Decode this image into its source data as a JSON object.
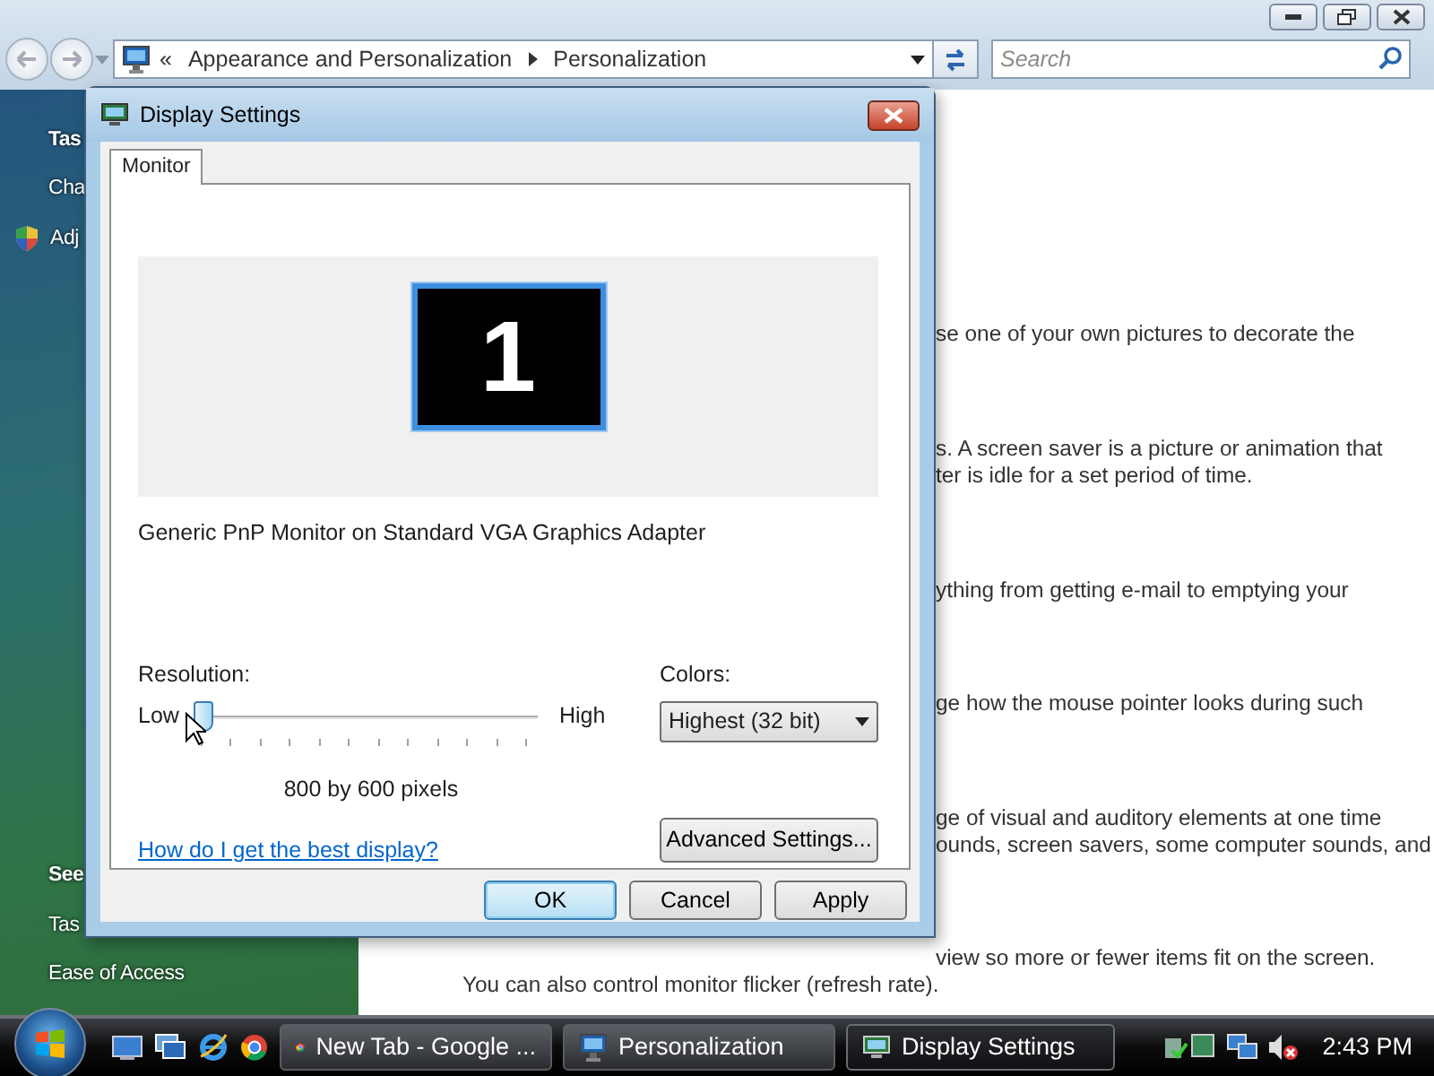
{
  "explorer": {
    "address_bar": {
      "chevron": "«",
      "breadcrumbs": [
        "Appearance and Personalization",
        "Personalization"
      ]
    },
    "search": {
      "placeholder": "Search"
    },
    "sidebar": {
      "sections": [
        {
          "heading": "Tas",
          "items": [
            {
              "label": "Cha",
              "kind": "plain"
            },
            {
              "label": "Adj",
              "kind": "shield"
            }
          ]
        },
        {
          "heading": "See",
          "items": [
            {
              "label": "Tas",
              "kind": "plain"
            },
            {
              "label": "Ease of Access",
              "kind": "plain"
            }
          ]
        }
      ]
    },
    "paragraphs": [
      {
        "lines": [
          {
            "text": "se one of your own pictures to decorate the",
            "kind": "cut"
          }
        ]
      },
      {
        "lines": [
          {
            "text": "s. A screen saver is a picture or animation that",
            "kind": "cut"
          },
          {
            "text": "ter is idle for a set period of time.",
            "kind": "cut"
          }
        ]
      },
      {
        "lines": [
          {
            "text": "ything from getting e-mail to emptying your",
            "kind": "cut"
          }
        ]
      },
      {
        "lines": [
          {
            "text": "ge how the mouse pointer looks during such",
            "kind": "cut"
          }
        ]
      },
      {
        "lines": [
          {
            "text": "ge of visual and auditory elements at one time",
            "kind": "cut"
          },
          {
            "text": "ounds, screen savers, some computer sounds, and",
            "kind": "cut"
          }
        ]
      },
      {
        "lines": [
          {
            "text": "view so more or fewer items fit on the screen.",
            "kind": "cut"
          },
          {
            "text": "You can also control monitor flicker (refresh rate).",
            "kind": "full"
          }
        ]
      }
    ]
  },
  "dialog": {
    "title": "Display Settings",
    "tabs": [
      {
        "label": "Monitor",
        "selected": true
      }
    ],
    "monitor_number": "1",
    "monitor_description": "Generic PnP Monitor on Standard VGA Graphics Adapter",
    "resolution": {
      "label": "Resolution:",
      "low": "Low",
      "high": "High",
      "level": 0,
      "reading": "800 by 600 pixels"
    },
    "colors": {
      "label": "Colors:",
      "value": "Highest (32 bit)"
    },
    "help_link": "How do I get the best display?",
    "advanced_button": "Advanced Settings...",
    "buttons": [
      {
        "label": "OK",
        "default": true
      },
      {
        "label": "Cancel",
        "default": false
      },
      {
        "label": "Apply",
        "default": false
      }
    ]
  },
  "taskbar": {
    "tasks": [
      {
        "label": "New Tab - Google ...",
        "kind": "browser",
        "selected": false
      },
      {
        "label": "Personalization",
        "kind": "monitor",
        "selected": false
      },
      {
        "label": "Display Settings",
        "kind": "display",
        "selected": true
      }
    ],
    "clock": "2:43 PM"
  }
}
